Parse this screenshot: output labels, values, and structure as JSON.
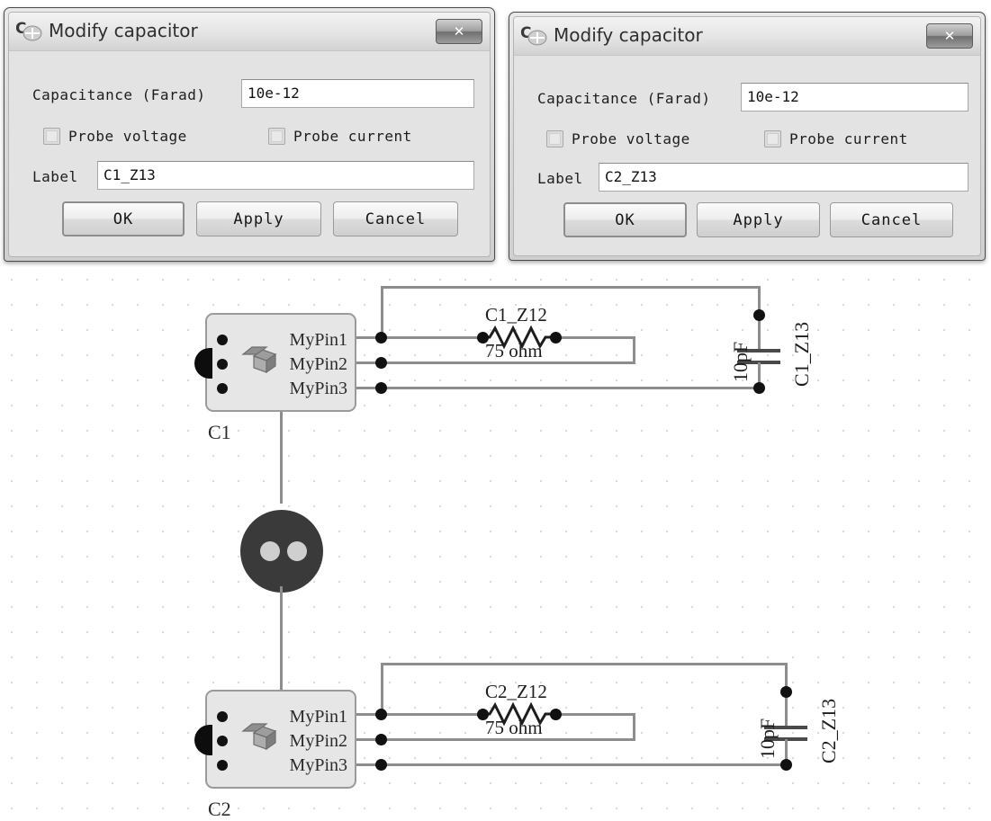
{
  "dialogs": [
    {
      "id": "dialog-c1",
      "title": "Modify capacitor",
      "icon": "capacitor-icon",
      "close_label": "✕",
      "capacitance_label": "Capacitance (Farad)",
      "capacitance_value": "10e-12",
      "probe_voltage_label": "Probe voltage",
      "probe_current_label": "Probe current",
      "probe_voltage_checked": false,
      "probe_current_checked": false,
      "label_label": "Label",
      "label_value": "C1_Z13",
      "ok_label": "OK",
      "apply_label": "Apply",
      "cancel_label": "Cancel"
    },
    {
      "id": "dialog-c2",
      "title": "Modify capacitor",
      "icon": "capacitor-icon",
      "close_label": "✕",
      "capacitance_label": "Capacitance (Farad)",
      "capacitance_value": "10e-12",
      "probe_voltage_label": "Probe voltage",
      "probe_current_label": "Probe current",
      "probe_voltage_checked": false,
      "probe_current_checked": false,
      "label_label": "Label",
      "label_value": "C2_Z13",
      "ok_label": "OK",
      "apply_label": "Apply",
      "cancel_label": "Cancel"
    }
  ],
  "schematic": {
    "blocks": [
      {
        "ref": "C1",
        "pins": [
          "MyPin1",
          "MyPin2",
          "MyPin3"
        ]
      },
      {
        "ref": "C2",
        "pins": [
          "MyPin1",
          "MyPin2",
          "MyPin3"
        ]
      }
    ],
    "resistors": [
      {
        "name": "C1_Z12",
        "value": "75 ohm"
      },
      {
        "name": "C2_Z12",
        "value": "75 ohm"
      }
    ],
    "capacitors": [
      {
        "name": "C1_Z13",
        "value": "10pF"
      },
      {
        "name": "C2_Z13",
        "value": "10pF"
      }
    ],
    "connector": {
      "name": "two-pin-connector"
    }
  },
  "colors": {
    "wire": "#8d8d8d",
    "node": "#111111",
    "block_fill": "#e6e6e6",
    "block_border": "#9a9a9a",
    "connector_fill": "#3a3a3a",
    "grid_dot": "#d8d8d8"
  }
}
